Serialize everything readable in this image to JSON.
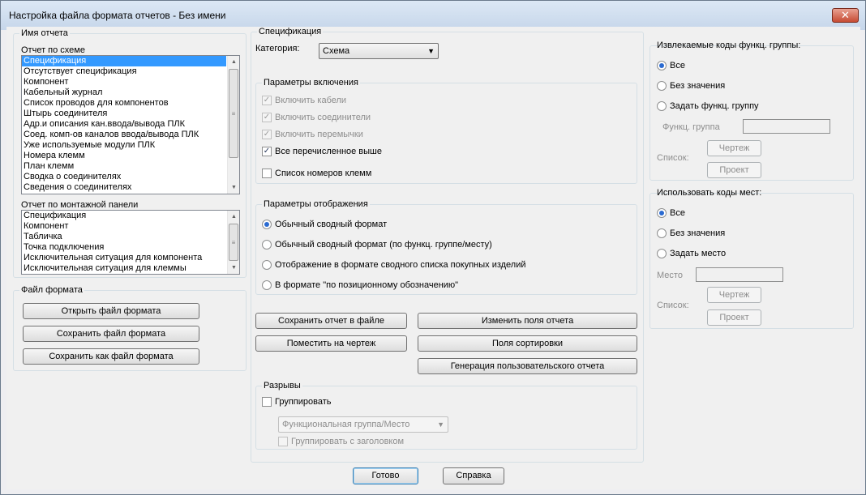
{
  "window": {
    "title": "Настройка файла формата отчетов - Без имени",
    "close_glyph": "✕"
  },
  "report_name": {
    "group_label": "Имя отчета",
    "schematic": {
      "label": "Отчет по схеме",
      "items": [
        "Спецификация",
        "Отсутствует спецификация",
        "Компонент",
        "Кабельный журнал",
        "Список проводов для компонентов",
        "Штырь соединителя",
        "Адр.и описания кан.ввода/вывода ПЛК",
        "Соед. комп-ов каналов ввода/вывода ПЛК",
        "Уже используемые модули ПЛК",
        "Номера клемм",
        "План клемм",
        "Сводка о соединителях",
        "Сведения о соединителях"
      ],
      "selected_index": 0
    },
    "panel": {
      "label": "Отчет по монтажной панели",
      "items": [
        "Спецификация",
        "Компонент",
        "Табличка",
        "Точка подключения",
        "Исключительная ситуация для компонента",
        "Исключительная ситуация для клеммы"
      ]
    }
  },
  "format_file": {
    "group_label": "Файл формата",
    "open": "Открыть файл формата",
    "save": "Сохранить файл формата",
    "save_as": "Сохранить как файл формата"
  },
  "spec": {
    "group_label": "Спецификация",
    "category_label": "Категория:",
    "category_value": "Схема",
    "include": {
      "label": "Параметры включения",
      "cables": "Включить кабели",
      "connectors": "Включить соединители",
      "jumpers": "Включить перемычки",
      "all_above": "Все перечисленное выше",
      "terminal_numbers": "Список номеров клемм"
    },
    "display": {
      "label": "Параметры отображения",
      "normal": "Обычный сводный формат",
      "normal_by_group": "Обычный сводный формат (по функц. группе/месту)",
      "purchase_list": "Отображение в формате сводного списка покупных изделий",
      "by_tag": "В формате \"по позиционному обозначению\""
    },
    "buttons": {
      "save_report": "Сохранить отчет в файле",
      "place_on_drawing": "Поместить на чертеж",
      "edit_fields": "Изменить поля отчета",
      "sort_fields": "Поля сортировки",
      "user_report": "Генерация пользовательского отчета"
    },
    "breaks": {
      "label": "Разрывы",
      "group": "Группировать",
      "group_by_value": "Функциональная группа/Место",
      "with_header": "Группировать с заголовком"
    }
  },
  "func_group_codes": {
    "label": "Извлекаемые коды функц. группы:",
    "all": "Все",
    "no_value": "Без значения",
    "set": "Задать функц. группу",
    "field_label": "Функц. группа",
    "list_label": "Список:",
    "drawing": "Чертеж",
    "project": "Проект"
  },
  "location_codes": {
    "label": "Использовать коды мест:",
    "all": "Все",
    "no_value": "Без значения",
    "set": "Задать место",
    "field_label": "Место",
    "list_label": "Список:",
    "drawing": "Чертеж",
    "project": "Проект"
  },
  "footer": {
    "ok": "Готово",
    "help": "Справка"
  }
}
